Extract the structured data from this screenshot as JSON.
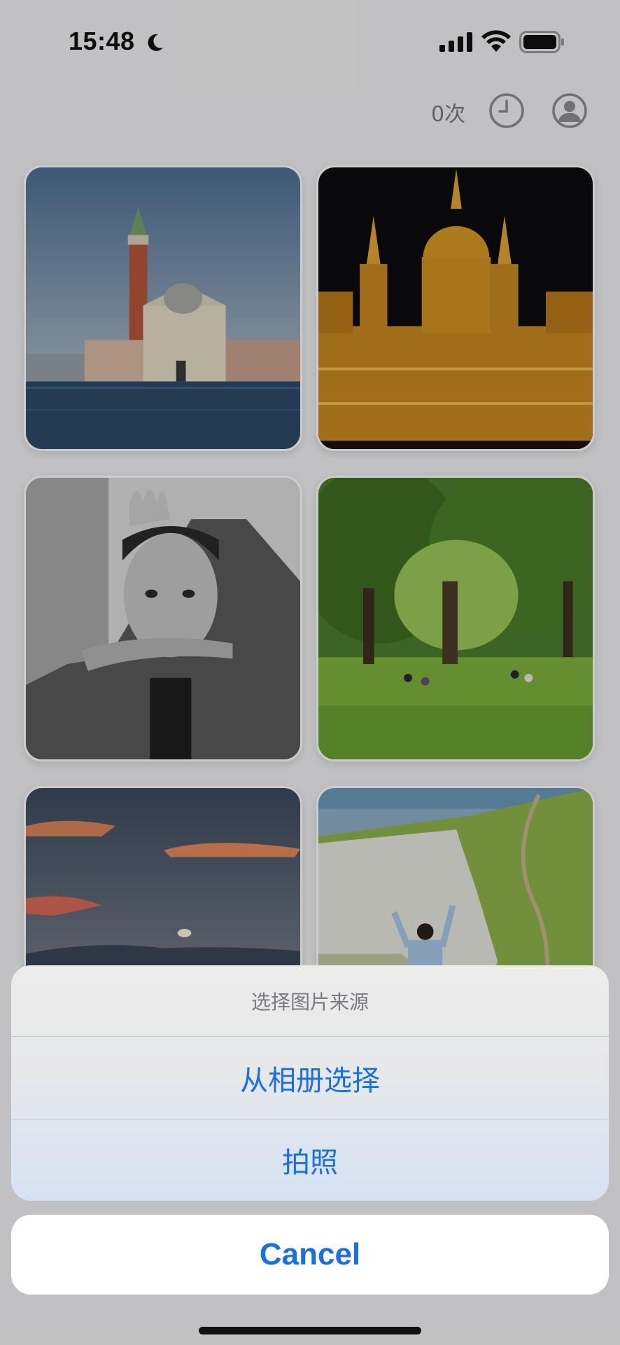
{
  "status_bar": {
    "time": "15:48",
    "icons": [
      "moon-icon",
      "cellular-signal-icon",
      "wifi-icon",
      "battery-icon"
    ]
  },
  "toolbar": {
    "count_label": "0次",
    "history_icon": "clock-icon",
    "profile_icon": "person-circle-icon"
  },
  "photos": [
    {
      "subject": "venice-church-island"
    },
    {
      "subject": "budapest-parliament-night"
    },
    {
      "subject": "bw-portrait-man"
    },
    {
      "subject": "park-trees-people"
    },
    {
      "subject": "sunset-sky"
    },
    {
      "subject": "white-cliffs-person"
    }
  ],
  "action_sheet": {
    "title": "选择图片来源",
    "options": [
      "从相册选择",
      "拍照"
    ],
    "cancel_label": "Cancel"
  },
  "colors": {
    "accent": "#1b6fe4",
    "sheet_title": "#7a7a80"
  }
}
